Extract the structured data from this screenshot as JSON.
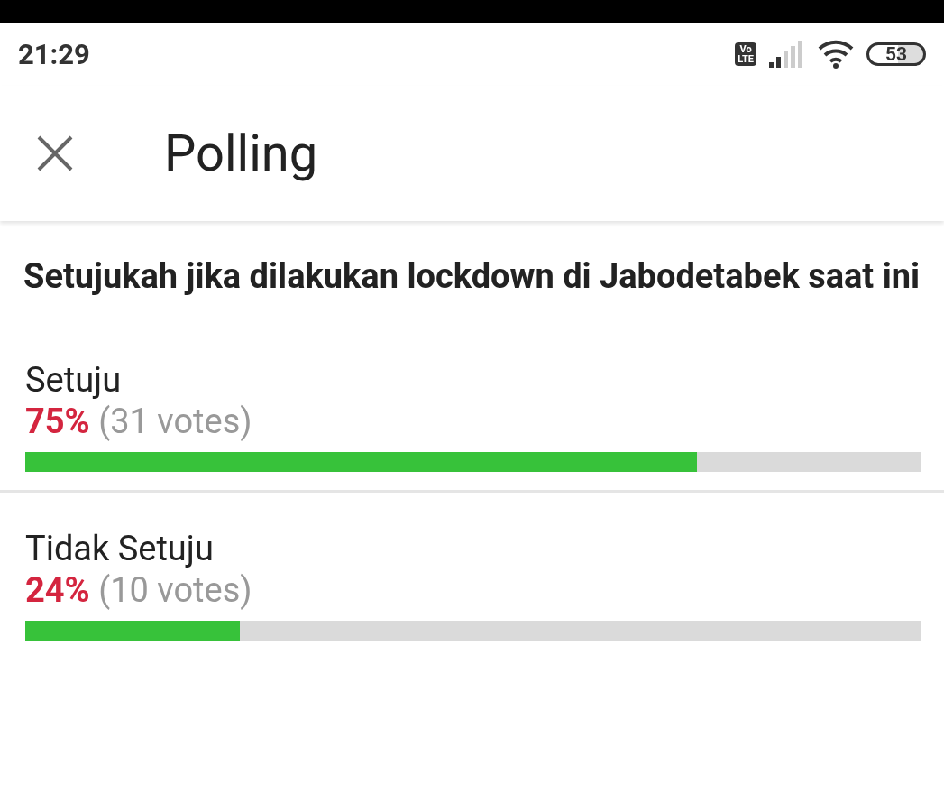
{
  "status_bar": {
    "time": "21:29",
    "network_badge": [
      "Vo",
      "LTE"
    ],
    "battery": "53"
  },
  "app_bar": {
    "title": "Polling"
  },
  "question": "Setujukah jika dilakukan lockdown di Jabodetabek saat ini",
  "options": [
    {
      "label": "Setuju",
      "percent": "75%",
      "votes": "(31 votes)",
      "level": 0.75
    },
    {
      "label": "Tidak Setuju",
      "percent": "24%",
      "votes": "(10 votes)",
      "level": 0.24
    }
  ]
}
